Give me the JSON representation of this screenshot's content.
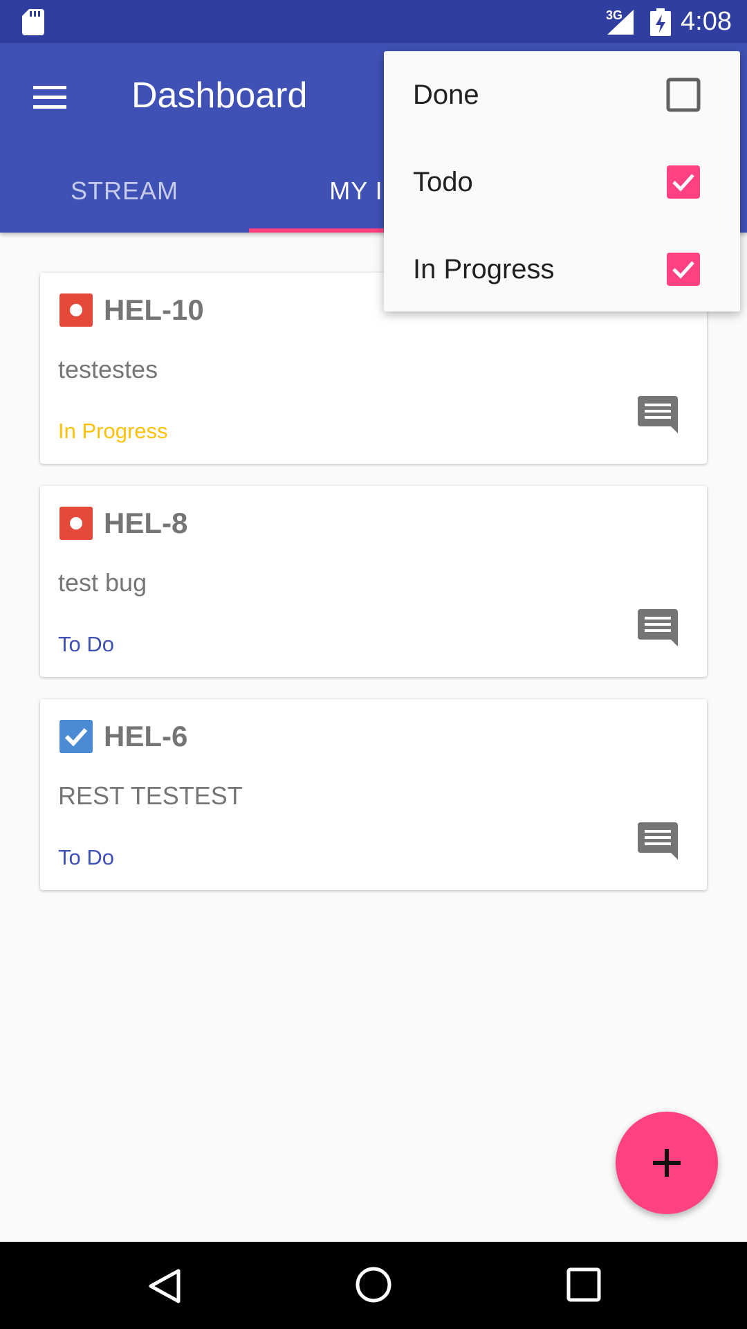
{
  "status_bar": {
    "network": "3G",
    "time": "4:08",
    "icons": [
      "sd-card-icon",
      "signal-icon",
      "battery-charging-icon"
    ]
  },
  "app_bar": {
    "title": "Dashboard",
    "menu_icon": "hamburger-menu-icon",
    "tabs": [
      {
        "label": "STREAM",
        "selected": false
      },
      {
        "label": "MY ISS",
        "selected": true
      }
    ],
    "accent": "#ff4081",
    "color": "#3f51b5"
  },
  "filter_menu": {
    "items": [
      {
        "label": "Done",
        "checked": false
      },
      {
        "label": "Todo",
        "checked": true
      },
      {
        "label": "In Progress",
        "checked": true
      }
    ]
  },
  "issues": [
    {
      "key": "HEL-10",
      "summary": "testestes",
      "status": "In Progress",
      "status_color": "#ffc107",
      "type_icon": "bug-icon"
    },
    {
      "key": "HEL-8",
      "summary": "test bug",
      "status": "To Do",
      "status_color": "#3f51b5",
      "type_icon": "bug-icon"
    },
    {
      "key": "HEL-6",
      "summary": "REST TESTEST",
      "status": "To Do",
      "status_color": "#3f51b5",
      "type_icon": "task-icon"
    }
  ],
  "fab": {
    "icon": "plus-icon"
  },
  "nav_bar": {
    "icons": [
      "back-icon",
      "home-icon",
      "recents-icon"
    ]
  }
}
